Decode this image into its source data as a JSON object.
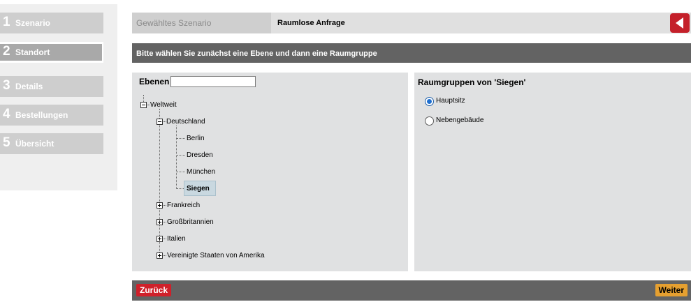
{
  "sidebar": {
    "steps": [
      {
        "number": "1",
        "label": "Szenario"
      },
      {
        "number": "2",
        "label": "Standort"
      },
      {
        "number": "3",
        "label": "Details"
      },
      {
        "number": "4",
        "label": "Bestellungen"
      },
      {
        "number": "5",
        "label": "Übersicht"
      }
    ],
    "active_step": 2
  },
  "header": {
    "scenario_label": "Gewähltes Szenario",
    "scenario_value": "Raumlose Anfrage",
    "back_icon": "chevron-left-icon"
  },
  "instruction": "Bitte wählen Sie zunächst eine Ebene und dann eine Raumgruppe",
  "levels": {
    "title": "Ebenen",
    "search_value": "",
    "tree": {
      "root": "Weltweit",
      "country_expanded": "Deutschland",
      "cities": [
        "Berlin",
        "Dresden",
        "München",
        "Siegen"
      ],
      "selected_city": "Siegen",
      "other_countries": [
        "Frankreich",
        "Großbritannien",
        "Italien",
        "Vereinigte Staaten von Amerika"
      ]
    }
  },
  "groups": {
    "title": "Raumgruppen von 'Siegen'",
    "options": [
      "Hauptsitz",
      "Nebengebäude"
    ],
    "selected": "Hauptsitz"
  },
  "footer": {
    "back_label": "Zurück",
    "next_label": "Weiter"
  },
  "colors": {
    "accent_red": "#c4202a",
    "next_orange": "#e6a030",
    "bar_dark": "#636363",
    "radio_blue": "#1e6fd0"
  }
}
